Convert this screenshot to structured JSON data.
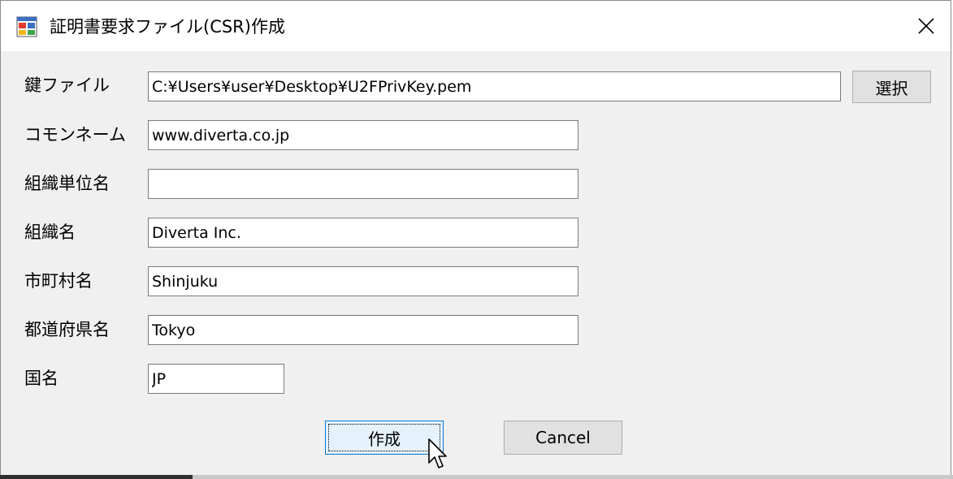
{
  "window": {
    "title": "証明書要求ファイル(CSR)作成",
    "app_icon": "windows-app-icon",
    "close_icon": "close-icon"
  },
  "form": {
    "key_file": {
      "label": "鍵ファイル",
      "value": "C:¥Users¥user¥Desktop¥U2FPrivKey.pem"
    },
    "select_button": "選択",
    "common_name": {
      "label": "コモンネーム",
      "value": "www.diverta.co.jp"
    },
    "org_unit": {
      "label": "組織単位名",
      "value": ""
    },
    "org_name": {
      "label": "組織名",
      "value": "Diverta Inc."
    },
    "city": {
      "label": "市町村名",
      "value": "Shinjuku"
    },
    "state": {
      "label": "都道府県名",
      "value": "Tokyo"
    },
    "country": {
      "label": "国名",
      "value": "JP"
    }
  },
  "buttons": {
    "create": "作成",
    "cancel": "Cancel"
  },
  "colors": {
    "dialog_bg": "#f0f0f0",
    "focus_border": "#0078d7",
    "button_bg": "#e1e1e1"
  }
}
